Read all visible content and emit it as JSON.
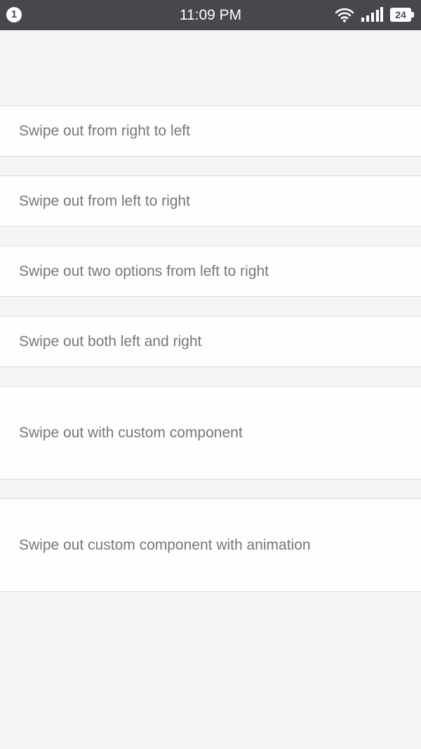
{
  "status_bar": {
    "notification_count": "1",
    "time": "11:09 PM",
    "battery_level": "24",
    "icons": [
      "notification-badge-icon",
      "wifi-icon",
      "signal-icon",
      "battery-icon"
    ],
    "background_color": "#48474b"
  },
  "list": {
    "items": [
      {
        "label": "Swipe out from right to left"
      },
      {
        "label": "Swipe out from left to right"
      },
      {
        "label": "Swipe out two options from left to right"
      },
      {
        "label": "Swipe out both left and right"
      },
      {
        "label": "Swipe out with custom component"
      },
      {
        "label": "Swipe out custom component with animation"
      }
    ]
  },
  "colors": {
    "page_background": "#f4f3f6",
    "row_background": "#fefefe",
    "row_text": "#77767a",
    "divider": "#dedde0"
  }
}
